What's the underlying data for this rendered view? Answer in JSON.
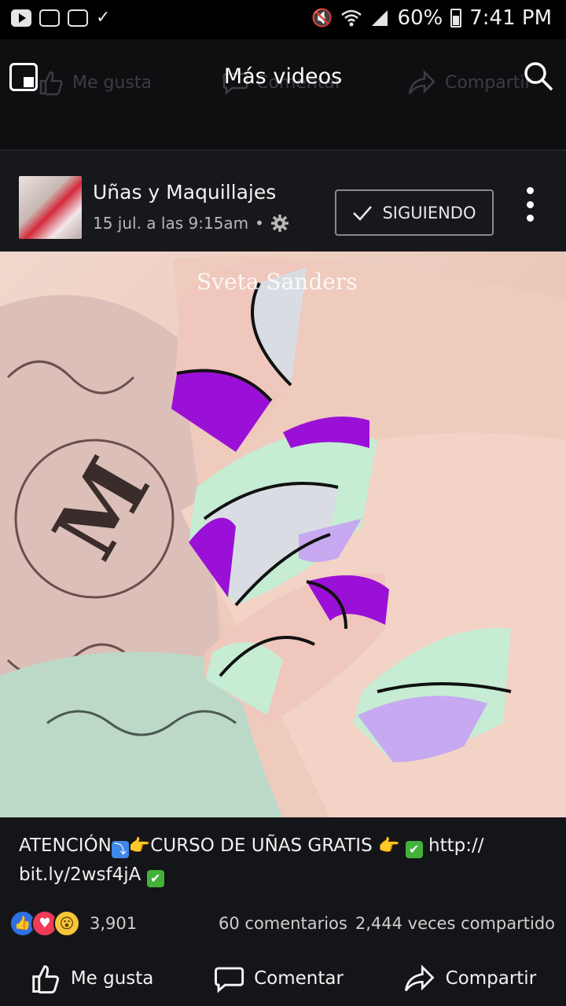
{
  "status_bar": {
    "battery": "60%",
    "time": "7:41 PM"
  },
  "top_bar": {
    "title": "Más videos",
    "ghost_like": "Me gusta",
    "ghost_comment": "Comentar",
    "ghost_share": "Compartir"
  },
  "post": {
    "page_name": "Uñas y Maquillajes",
    "date": "15 jul. a las 9:15am",
    "separator": "•",
    "follow_label": "SIGUIENDO",
    "watermark": "Sveta Sanders",
    "caption": {
      "part1": "ATENCIÓN",
      "arrow": "⤵",
      "hand1": "👉",
      "part2": "CURSO DE UÑAS GRATIS ",
      "hand2": "👉",
      "check1": "✔",
      "link1": " http://",
      "link2": "bit.ly/2wsf4jA ",
      "check2": "✔"
    },
    "reactions": {
      "types": [
        "like",
        "love",
        "wow"
      ],
      "count": "3,901"
    },
    "comments": "60 comentarios",
    "shares": "2,444 veces compartido"
  },
  "actions": {
    "like": "Me gusta",
    "comment": "Comentar",
    "share": "Compartir"
  },
  "colors": {
    "background": "#141518",
    "like_blue": "#2f6fe4",
    "love_red": "#ef3b57",
    "wow_yellow": "#f6c53a",
    "nail_purple": "#9b10d6",
    "nail_mint": "#c6ecd4",
    "nail_pink": "#efc7bd",
    "nail_lilac": "#c6a9f0"
  }
}
